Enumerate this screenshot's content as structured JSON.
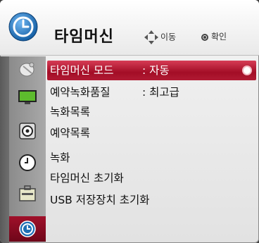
{
  "header": {
    "title": "타임머신",
    "hint_move": "이동",
    "hint_ok": "확인"
  },
  "sidebar": {
    "items": [
      {
        "icon": "satellite-dish-icon"
      },
      {
        "icon": "tv-screen-icon"
      },
      {
        "icon": "speaker-icon"
      },
      {
        "icon": "clock-icon"
      },
      {
        "icon": "toolbox-icon"
      },
      {
        "icon": "timemachine-icon",
        "active": true
      }
    ]
  },
  "menu": {
    "rows": [
      {
        "label": "타임머신 모드",
        "value": ": 자동",
        "selected": true
      },
      {
        "label": "예약녹화품질",
        "value": ": 최고급"
      },
      {
        "label": "녹화목록"
      },
      {
        "label": "예약목록"
      },
      {
        "label": "녹화"
      },
      {
        "label": "타임머신 초기화"
      },
      {
        "label": "USB 저장장치 초기화"
      }
    ]
  },
  "colors": {
    "accent": "#b01a33",
    "sidebar": "#9a9a9a",
    "header_icon": "#1f6fb4"
  }
}
